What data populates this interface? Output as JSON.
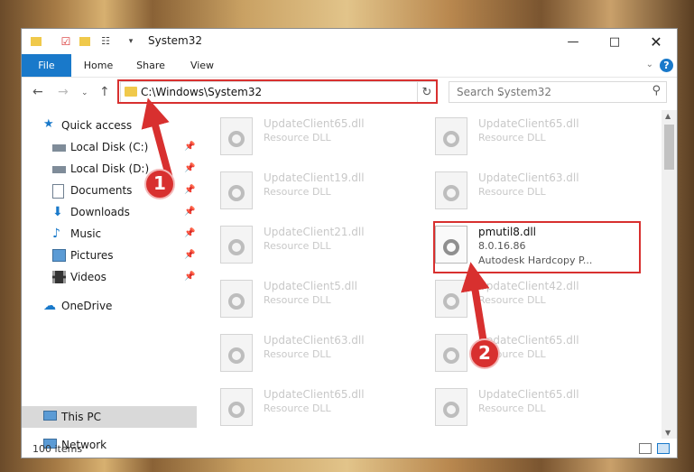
{
  "window": {
    "title": "System32"
  },
  "ribbon": {
    "tabs": [
      "File",
      "Home",
      "Share",
      "View"
    ]
  },
  "address": {
    "path": "C:\\Windows\\System32",
    "search_placeholder": "Search System32"
  },
  "sidebar": {
    "quick_access": "Quick access",
    "items": [
      "Local Disk (C:)",
      "Local Disk (D:)",
      "Documents",
      "Downloads",
      "Music",
      "Pictures",
      "Videos"
    ],
    "onedrive": "OneDrive",
    "this_pc": "This PC",
    "network": "Network"
  },
  "files": {
    "left": [
      {
        "name": "UpdateClient65.dll",
        "type": "Resource DLL"
      },
      {
        "name": "UpdateClient19.dll",
        "type": "Resource DLL"
      },
      {
        "name": "UpdateClient21.dll",
        "type": "Resource DLL"
      },
      {
        "name": "UpdateClient5.dll",
        "type": "Resource DLL"
      },
      {
        "name": "UpdateClient63.dll",
        "type": "Resource DLL"
      },
      {
        "name": "UpdateClient65.dll",
        "type": "Resource DLL"
      }
    ],
    "right": [
      {
        "name": "UpdateClient65.dll",
        "type": "Resource DLL"
      },
      {
        "name": "UpdateClient63.dll",
        "type": "Resource DLL"
      },
      {
        "name": "pmutil8.dll",
        "version": "8.0.16.86",
        "desc": "Autodesk Hardcopy P..."
      },
      {
        "name": "UpdateClient42.dll",
        "type": "Resource DLL"
      },
      {
        "name": "UpdateClient65.dll",
        "type": "Resource DLL"
      },
      {
        "name": "UpdateClient65.dll",
        "type": "Resource DLL"
      }
    ]
  },
  "status": {
    "count": "100 items"
  },
  "annotations": {
    "step1": "1",
    "step2": "2"
  },
  "colors": {
    "accent": "#1979ca",
    "highlight": "#d8302f"
  }
}
